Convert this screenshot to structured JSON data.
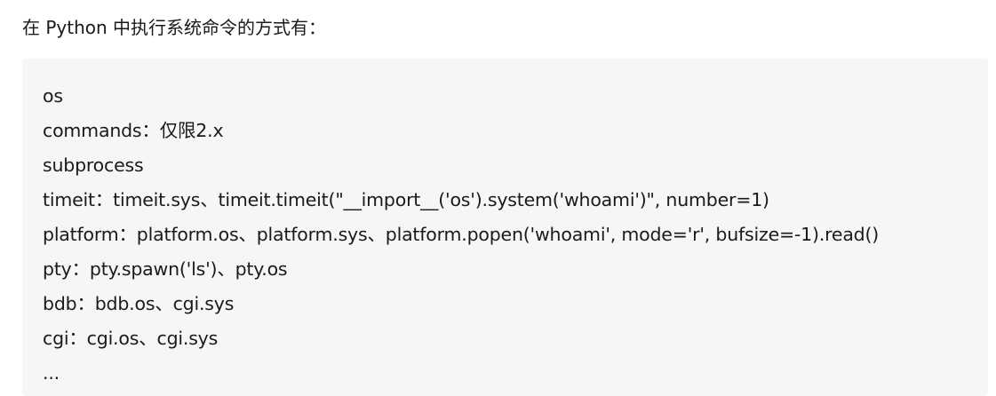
{
  "intro": "在 Python 中执行系统命令的方式有：",
  "items": [
    "os",
    "commands：仅限2.x",
    "subprocess",
    "timeit：timeit.sys、timeit.timeit(\"__import__('os').system('whoami')\", number=1)",
    "platform：platform.os、platform.sys、platform.popen('whoami', mode='r', bufsize=-1).read()",
    "pty：pty.spawn('ls')、pty.os",
    "bdb：bdb.os、cgi.sys",
    "cgi：cgi.os、cgi.sys",
    "..."
  ]
}
